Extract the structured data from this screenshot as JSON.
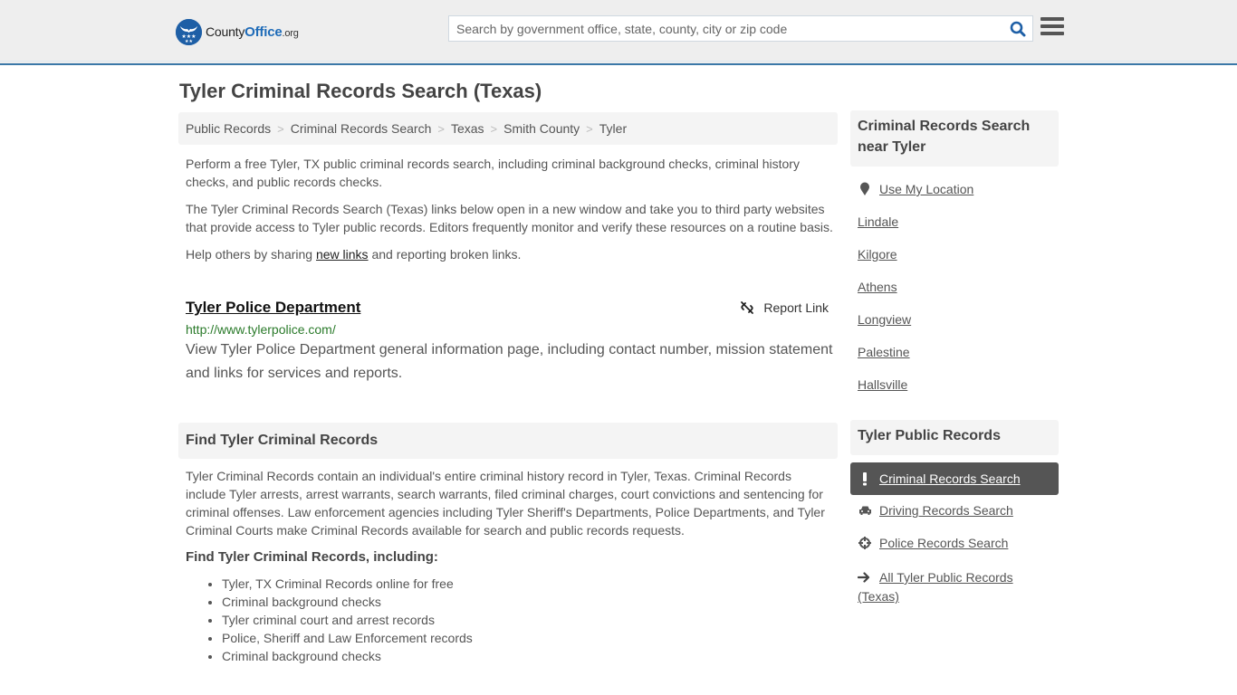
{
  "header": {
    "logo": {
      "part1": "County",
      "part2": "Office",
      "part3": ".org"
    },
    "search_placeholder": "Search by government office, state, county, city or zip code",
    "search_value": "",
    "icons": {
      "search": "search-icon",
      "menu": "hamburger-menu-icon",
      "logo": "eagle-stars-badge"
    }
  },
  "page": {
    "title": "Tyler Criminal Records Search (Texas)"
  },
  "breadcrumb": [
    {
      "label": "Public Records"
    },
    {
      "label": "Criminal Records Search"
    },
    {
      "label": "Texas"
    },
    {
      "label": "Smith County"
    },
    {
      "label": "Tyler"
    }
  ],
  "breadcrumb_separator": ">",
  "intro": {
    "p1": "Perform a free Tyler, TX public criminal records search, including criminal background checks, criminal history checks, and public records checks.",
    "p2": "The Tyler Criminal Records Search (Texas) links below open in a new window and take you to third party websites that provide access to Tyler public records. Editors frequently monitor and verify these resources on a routine basis.",
    "p3_before": "Help others by sharing ",
    "p3_link": "new links",
    "p3_after": " and reporting broken links."
  },
  "listing": {
    "title": "Tyler Police Department",
    "url": "http://www.tylerpolice.com/",
    "description": "View Tyler Police Department general information page, including contact number, mission statement and links for services and reports.",
    "report_label": "Report Link",
    "report_icon": "broken-link-icon"
  },
  "find_section": {
    "heading": "Find Tyler Criminal Records",
    "body": "Tyler Criminal Records contain an individual's entire criminal history record in Tyler, Texas. Criminal Records include Tyler arrests, arrest warrants, search warrants, filed criminal charges, court convictions and sentencing for criminal offenses. Law enforcement agencies including Tyler Sheriff's Departments, Police Departments, and Tyler Criminal Courts make Criminal Records available for search and public records requests.",
    "subheading": "Find Tyler Criminal Records, including:",
    "bullets": [
      "Tyler, TX Criminal Records online for free",
      "Criminal background checks",
      "Tyler criminal court and arrest records",
      "Police, Sheriff and Law Enforcement records",
      "Criminal background checks"
    ]
  },
  "sidebar": {
    "nearby": {
      "heading_line1": "Criminal Records Search",
      "heading_line2": "near Tyler",
      "use_location": "Use My Location",
      "cities": [
        "Lindale",
        "Kilgore",
        "Athens",
        "Longview",
        "Palestine",
        "Hallsville"
      ]
    },
    "public_records": {
      "heading": "Tyler Public Records",
      "items": [
        {
          "label": "Criminal Records Search",
          "icon": "exclamation-icon",
          "active": true
        },
        {
          "label": "Driving Records Search",
          "icon": "car-icon",
          "active": false
        },
        {
          "label": "Police Records Search",
          "icon": "crosshairs-icon",
          "active": false
        }
      ],
      "all_records": "All Tyler Public Records (Texas)"
    }
  },
  "colors": {
    "brand_blue": "#1e5fa6",
    "header_border": "#3a78a8",
    "url_green": "#2a7a2a",
    "active_bg": "#555555",
    "panel_bg": "#f4f4f4"
  }
}
